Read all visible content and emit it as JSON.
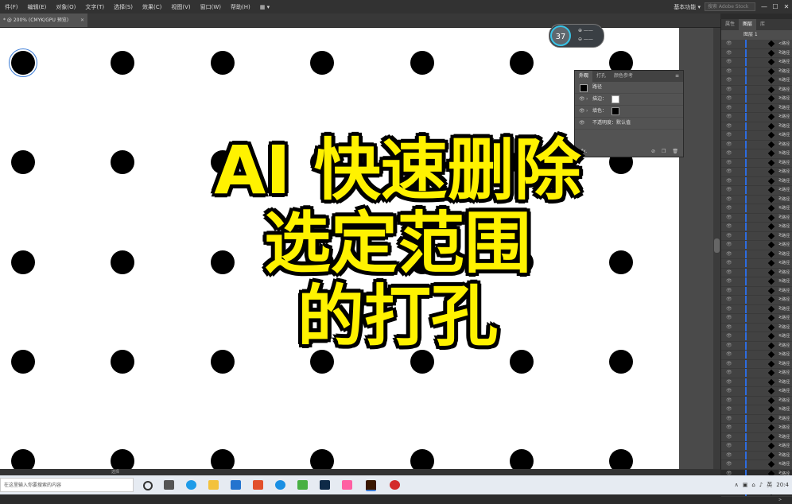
{
  "menubar": {
    "items": [
      "件(F)",
      "编辑(E)",
      "对象(O)",
      "文字(T)",
      "选择(S)",
      "效果(C)",
      "视图(V)",
      "窗口(W)",
      "帮助(H)",
      "▦ ▾"
    ],
    "workspace": "基本功能 ▾",
    "search_placeholder": "搜索 Adobe Stock",
    "win_min": "—",
    "win_max": "☐",
    "win_close": "✕"
  },
  "document_tab": {
    "title": "* @ 200% (CMYK/GPU 预览)",
    "close": "✕"
  },
  "zoom_indicator": {
    "value": "37",
    "item1": "⊕ ——",
    "item2": "⊖ ——"
  },
  "appearance_panel": {
    "tabs": [
      "外观",
      "打孔",
      "颜色参考"
    ],
    "menu": "≡",
    "object_label": "路径",
    "stroke_label": "描边：",
    "fill_label": "填色：",
    "opacity_label": "不透明度：默认值",
    "fx_label": "fx.",
    "colors": {
      "stroke": "#ffffff",
      "fill": "#000000"
    }
  },
  "overlay_title": {
    "line1": "AI 快速删除",
    "line2": "选定范围",
    "line3": "的打孔"
  },
  "layers_panel": {
    "tabs": [
      "属性",
      "图层",
      "库"
    ],
    "layer_name": "图层 1",
    "row_label": "<路径>"
  },
  "statusbar": {
    "text": "选择"
  },
  "taskbar": {
    "search_placeholder": "在这里输入你要搜索的内容",
    "tray_lang": "英",
    "tray_time": "20:4"
  }
}
